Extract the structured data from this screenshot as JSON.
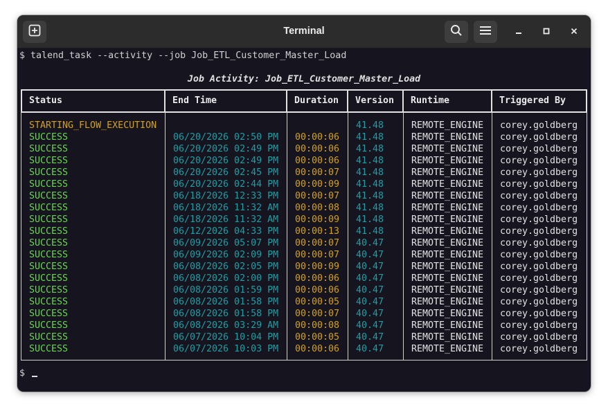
{
  "window": {
    "title": "Terminal",
    "new_tab_icon": "new-tab-icon",
    "search_icon": "search-icon",
    "menu_icon": "hamburger-menu-icon",
    "minimize_icon": "minimize-icon",
    "maximize_icon": "maximize-icon",
    "close_icon": "close-icon"
  },
  "terminal": {
    "command_line": "$ talend_task --activity --job Job_ETL_Customer_Master_Load",
    "job_title": "Job Activity: Job_ETL_Customer_Master_Load",
    "prompt": "$",
    "colors": {
      "background": "#16141f",
      "status_running": "#d4a20f",
      "status_success": "#67d84d",
      "end_time": "#18a0a7",
      "duration": "#d4a20f",
      "version": "#18a0a7",
      "plain": "#e2e2e2"
    }
  },
  "table": {
    "columns": [
      "Status",
      "End Time",
      "Duration",
      "Version",
      "Runtime",
      "Triggered By"
    ],
    "rows": [
      {
        "status": "STARTING_FLOW_EXECUTION",
        "end_time": "",
        "duration": "",
        "version": "41.48",
        "runtime": "REMOTE_ENGINE",
        "triggered_by": "corey.goldberg"
      },
      {
        "status": "SUCCESS",
        "end_time": "06/20/2026 02:50 PM",
        "duration": "00:00:06",
        "version": "41.48",
        "runtime": "REMOTE_ENGINE",
        "triggered_by": "corey.goldberg"
      },
      {
        "status": "SUCCESS",
        "end_time": "06/20/2026 02:49 PM",
        "duration": "00:00:06",
        "version": "41.48",
        "runtime": "REMOTE_ENGINE",
        "triggered_by": "corey.goldberg"
      },
      {
        "status": "SUCCESS",
        "end_time": "06/20/2026 02:49 PM",
        "duration": "00:00:06",
        "version": "41.48",
        "runtime": "REMOTE_ENGINE",
        "triggered_by": "corey.goldberg"
      },
      {
        "status": "SUCCESS",
        "end_time": "06/20/2026 02:45 PM",
        "duration": "00:00:07",
        "version": "41.48",
        "runtime": "REMOTE_ENGINE",
        "triggered_by": "corey.goldberg"
      },
      {
        "status": "SUCCESS",
        "end_time": "06/20/2026 02:44 PM",
        "duration": "00:00:09",
        "version": "41.48",
        "runtime": "REMOTE_ENGINE",
        "triggered_by": "corey.goldberg"
      },
      {
        "status": "SUCCESS",
        "end_time": "06/18/2026 12:33 PM",
        "duration": "00:00:07",
        "version": "41.48",
        "runtime": "REMOTE_ENGINE",
        "triggered_by": "corey.goldberg"
      },
      {
        "status": "SUCCESS",
        "end_time": "06/18/2026 11:32 AM",
        "duration": "00:00:08",
        "version": "41.48",
        "runtime": "REMOTE_ENGINE",
        "triggered_by": "corey.goldberg"
      },
      {
        "status": "SUCCESS",
        "end_time": "06/18/2026 11:32 AM",
        "duration": "00:00:09",
        "version": "41.48",
        "runtime": "REMOTE_ENGINE",
        "triggered_by": "corey.goldberg"
      },
      {
        "status": "SUCCESS",
        "end_time": "06/12/2026 04:33 PM",
        "duration": "00:00:13",
        "version": "41.48",
        "runtime": "REMOTE_ENGINE",
        "triggered_by": "corey.goldberg"
      },
      {
        "status": "SUCCESS",
        "end_time": "06/09/2026 05:07 PM",
        "duration": "00:00:07",
        "version": "40.47",
        "runtime": "REMOTE_ENGINE",
        "triggered_by": "corey.goldberg"
      },
      {
        "status": "SUCCESS",
        "end_time": "06/09/2026 02:09 PM",
        "duration": "00:00:07",
        "version": "40.47",
        "runtime": "REMOTE_ENGINE",
        "triggered_by": "corey.goldberg"
      },
      {
        "status": "SUCCESS",
        "end_time": "06/08/2026 02:05 PM",
        "duration": "00:00:09",
        "version": "40.47",
        "runtime": "REMOTE_ENGINE",
        "triggered_by": "corey.goldberg"
      },
      {
        "status": "SUCCESS",
        "end_time": "06/08/2026 02:00 PM",
        "duration": "00:00:06",
        "version": "40.47",
        "runtime": "REMOTE_ENGINE",
        "triggered_by": "corey.goldberg"
      },
      {
        "status": "SUCCESS",
        "end_time": "06/08/2026 01:59 PM",
        "duration": "00:00:06",
        "version": "40.47",
        "runtime": "REMOTE_ENGINE",
        "triggered_by": "corey.goldberg"
      },
      {
        "status": "SUCCESS",
        "end_time": "06/08/2026 01:58 PM",
        "duration": "00:00:05",
        "version": "40.47",
        "runtime": "REMOTE_ENGINE",
        "triggered_by": "corey.goldberg"
      },
      {
        "status": "SUCCESS",
        "end_time": "06/08/2026 01:58 PM",
        "duration": "00:00:07",
        "version": "40.47",
        "runtime": "REMOTE_ENGINE",
        "triggered_by": "corey.goldberg"
      },
      {
        "status": "SUCCESS",
        "end_time": "06/08/2026 03:29 AM",
        "duration": "00:00:08",
        "version": "40.47",
        "runtime": "REMOTE_ENGINE",
        "triggered_by": "corey.goldberg"
      },
      {
        "status": "SUCCESS",
        "end_time": "06/07/2026 10:04 PM",
        "duration": "00:00:05",
        "version": "40.47",
        "runtime": "REMOTE_ENGINE",
        "triggered_by": "corey.goldberg"
      },
      {
        "status": "SUCCESS",
        "end_time": "06/07/2026 10:03 PM",
        "duration": "00:00:06",
        "version": "40.47",
        "runtime": "REMOTE_ENGINE",
        "triggered_by": "corey.goldberg"
      }
    ]
  }
}
